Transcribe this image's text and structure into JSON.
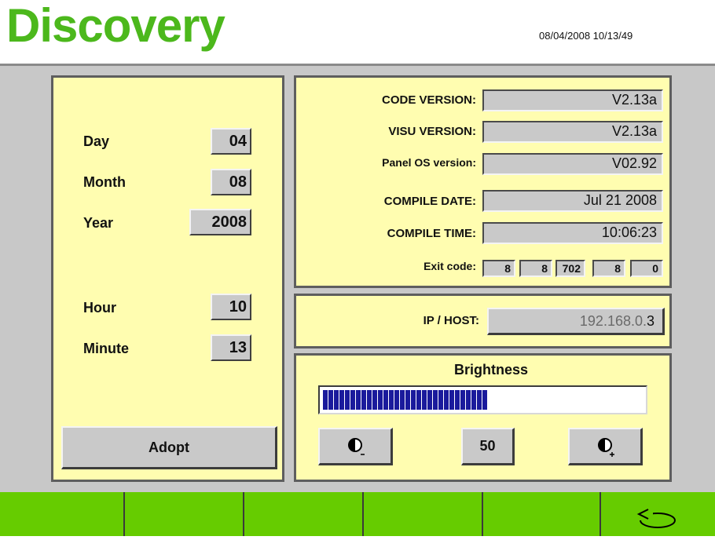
{
  "header": {
    "title": "Discovery",
    "datetime": "08/04/2008 10/13/49"
  },
  "date_panel": {
    "day_label": "Day",
    "day_value": "04",
    "month_label": "Month",
    "month_value": "08",
    "year_label": "Year",
    "year_value": "2008",
    "hour_label": "Hour",
    "hour_value": "10",
    "minute_label": "Minute",
    "minute_value": "13",
    "adopt_label": "Adopt"
  },
  "info_panel": {
    "code_version_label": "CODE VERSION:",
    "code_version_value": "V2.13a",
    "visu_version_label": "VISU VERSION:",
    "visu_version_value": "V2.13a",
    "panel_os_label": "Panel OS version:",
    "panel_os_value": "V02.92",
    "compile_date_label": "COMPILE DATE:",
    "compile_date_value": "Jul 21 2008",
    "compile_time_label": "COMPILE TIME:",
    "compile_time_value": "10:06:23",
    "exit_code_label": "Exit code:",
    "exit_codes": [
      "8",
      "8",
      "702",
      "8",
      "0"
    ]
  },
  "ip_panel": {
    "label": "IP / HOST:",
    "value_prefix": "192.168.0.",
    "value_suffix": "3"
  },
  "brightness_panel": {
    "title": "Brightness",
    "level": 50,
    "value_label": "50"
  },
  "icons": {
    "brightness_down": "contrast-minus-icon",
    "brightness_up": "contrast-plus-icon",
    "back": "return-arrow-icon"
  },
  "colors": {
    "title_green": "#4cb81c",
    "footer_green": "#66cc00",
    "panel_yellow": "#fffdb0",
    "bar_blue": "#1a1a9c"
  }
}
